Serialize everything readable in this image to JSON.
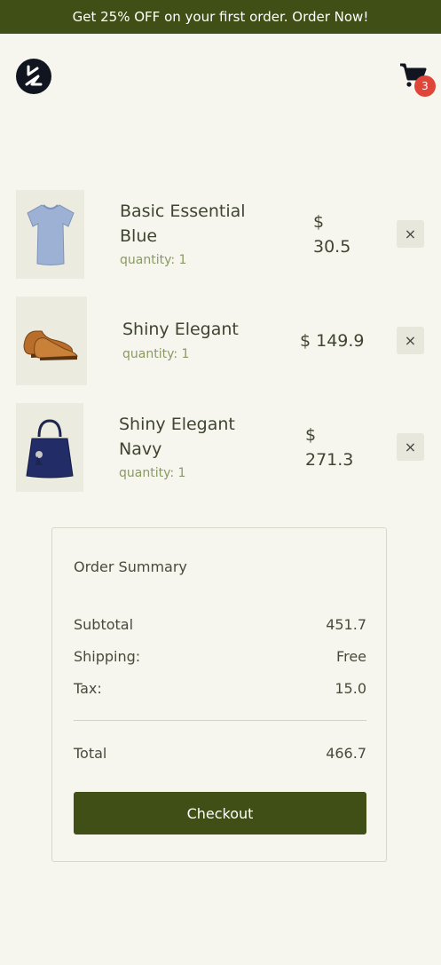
{
  "promo": {
    "text": "Get 25% OFF on your first order. Order Now!"
  },
  "header": {
    "logo_name": "brand-logo",
    "cart_count": "3"
  },
  "cart_items": [
    {
      "name_line1": "Basic Essential",
      "name_line2": "Blue",
      "quantity": "quantity: 1",
      "price_line1": "$",
      "price_line2": "30.5",
      "remove": "×"
    },
    {
      "name_line1": "Shiny Elegant",
      "quantity": "quantity: 1",
      "price": "$ 149.9",
      "remove": "×"
    },
    {
      "name_line1": "Shiny Elegant",
      "name_line2": "Navy",
      "quantity": "quantity: 1",
      "price_line1": "$",
      "price_line2": "271.3",
      "remove": "×"
    }
  ],
  "summary": {
    "title": "Order Summary",
    "subtotal_label": "Subtotal",
    "subtotal_value": "451.7",
    "shipping_label": "Shipping:",
    "shipping_value": "Free",
    "tax_label": "Tax:",
    "tax_value": "15.0",
    "total_label": "Total",
    "total_value": "466.7",
    "checkout_label": "Checkout"
  }
}
